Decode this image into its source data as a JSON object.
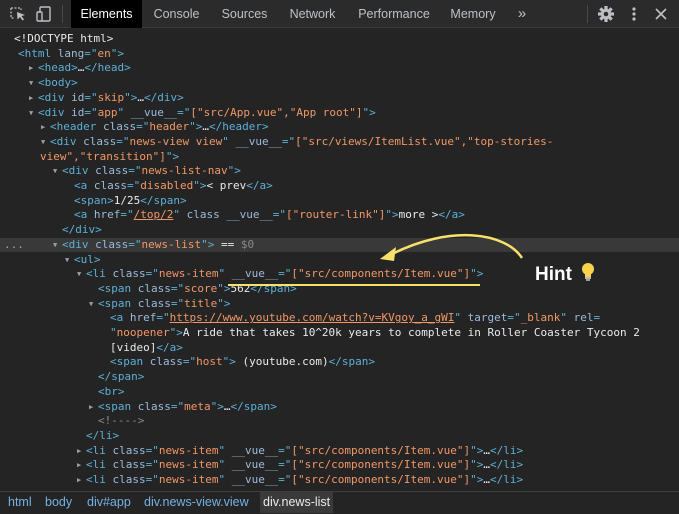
{
  "toolbar": {
    "tabs": [
      "Elements",
      "Console",
      "Sources",
      "Network",
      "Performance",
      "Memory"
    ],
    "more": "»",
    "icons": [
      "inspect-icon",
      "device-toggle-icon",
      "settings-icon",
      "more-vert-icon",
      "close-icon"
    ]
  },
  "lines": [
    [
      [
        "pl",
        "<!DOCTYPE html>"
      ]
    ],
    [
      [
        "tag",
        "<html "
      ],
      [
        "an",
        "lang"
      ],
      [
        "tag",
        "=\""
      ],
      [
        "av",
        "en"
      ],
      [
        "tag",
        "\">"
      ]
    ],
    [
      [
        "tag",
        "<head>"
      ],
      [
        "pl",
        "…"
      ],
      [
        "tag",
        "</head>"
      ]
    ],
    [
      [
        "tag",
        "<body>"
      ]
    ],
    [
      [
        "tag",
        "<div "
      ],
      [
        "an",
        "id"
      ],
      [
        "tag",
        "=\""
      ],
      [
        "av",
        "skip"
      ],
      [
        "tag",
        "\">"
      ],
      [
        "pl",
        "…"
      ],
      [
        "tag",
        "</div>"
      ]
    ],
    [
      [
        "tag",
        "<div "
      ],
      [
        "an",
        "id"
      ],
      [
        "tag",
        "=\""
      ],
      [
        "av",
        "app"
      ],
      [
        "tag",
        "\" "
      ],
      [
        "an",
        "__vue__"
      ],
      [
        "tag",
        "=\""
      ],
      [
        "av",
        "[\"src/App.vue\",\"App root\"]"
      ],
      [
        "tag",
        "\">"
      ]
    ],
    [
      [
        "tag",
        "<header "
      ],
      [
        "an",
        "class"
      ],
      [
        "tag",
        "=\""
      ],
      [
        "av",
        "header"
      ],
      [
        "tag",
        "\">"
      ],
      [
        "pl",
        "…"
      ],
      [
        "tag",
        "</header>"
      ]
    ],
    [
      [
        "tag",
        "<div "
      ],
      [
        "an",
        "class"
      ],
      [
        "tag",
        "=\""
      ],
      [
        "av",
        "news-view view"
      ],
      [
        "tag",
        "\" "
      ],
      [
        "an",
        "__vue__"
      ],
      [
        "tag",
        "=\""
      ],
      [
        "av",
        "[\"src/views/ItemList.vue\",\"top-stories-"
      ]
    ],
    [
      [
        "av",
        "view\",\"transition\"]"
      ],
      [
        "tag",
        "\">"
      ]
    ],
    [
      [
        "tag",
        "<div "
      ],
      [
        "an",
        "class"
      ],
      [
        "tag",
        "=\""
      ],
      [
        "av",
        "news-list-nav"
      ],
      [
        "tag",
        "\">"
      ]
    ],
    [
      [
        "tag",
        "<a "
      ],
      [
        "an",
        "class"
      ],
      [
        "tag",
        "=\""
      ],
      [
        "av",
        "disabled"
      ],
      [
        "tag",
        "\">"
      ],
      [
        "pl",
        "< prev"
      ],
      [
        "tag",
        "</a>"
      ]
    ],
    [
      [
        "tag",
        "<span>"
      ],
      [
        "pl",
        "1/25"
      ],
      [
        "tag",
        "</span>"
      ]
    ],
    [
      [
        "tag",
        "<a "
      ],
      [
        "an",
        "href"
      ],
      [
        "tag",
        "=\""
      ],
      [
        "avu",
        "/top/2"
      ],
      [
        "tag",
        "\" "
      ],
      [
        "an",
        "class"
      ],
      [
        "tag",
        " "
      ],
      [
        "an",
        "__vue__"
      ],
      [
        "tag",
        "=\""
      ],
      [
        "av",
        "[\"router-link\"]"
      ],
      [
        "tag",
        "\">"
      ],
      [
        "pl",
        "more >"
      ],
      [
        "tag",
        "</a>"
      ]
    ],
    [
      [
        "tag",
        "</div>"
      ]
    ],
    [
      [
        "tag",
        "<div "
      ],
      [
        "an",
        "class"
      ],
      [
        "tag",
        "=\""
      ],
      [
        "av",
        "news-list"
      ],
      [
        "tag",
        "\">"
      ],
      [
        "pl",
        " == "
      ],
      [
        "cm",
        "$0"
      ]
    ],
    [
      [
        "tag",
        "<ul>"
      ]
    ],
    [
      [
        "tag",
        "<li "
      ],
      [
        "an",
        "class"
      ],
      [
        "tag",
        "=\""
      ],
      [
        "av",
        "news-item"
      ],
      [
        "tag",
        "\" "
      ],
      [
        "an",
        "__vue__"
      ],
      [
        "tag",
        "=\""
      ],
      [
        "av",
        "[\"src/components/Item.vue\"]"
      ],
      [
        "tag",
        "\">"
      ]
    ],
    [
      [
        "tag",
        "<span "
      ],
      [
        "an",
        "class"
      ],
      [
        "tag",
        "=\""
      ],
      [
        "av",
        "score"
      ],
      [
        "tag",
        "\">"
      ],
      [
        "pl",
        "562"
      ],
      [
        "tag",
        "</span>"
      ]
    ],
    [
      [
        "tag",
        "<span "
      ],
      [
        "an",
        "class"
      ],
      [
        "tag",
        "=\""
      ],
      [
        "av",
        "title"
      ],
      [
        "tag",
        "\">"
      ]
    ],
    [
      [
        "tag",
        "<a "
      ],
      [
        "an",
        "href"
      ],
      [
        "tag",
        "=\""
      ],
      [
        "avu",
        "https://www.youtube.com/watch?v=KVgoy_a_gWI"
      ],
      [
        "tag",
        "\" "
      ],
      [
        "an",
        "target"
      ],
      [
        "tag",
        "=\""
      ],
      [
        "av",
        "_blank"
      ],
      [
        "tag",
        "\" "
      ],
      [
        "an",
        "rel"
      ],
      [
        "tag",
        "="
      ]
    ],
    [
      [
        "tag",
        "\""
      ],
      [
        "av",
        "noopener"
      ],
      [
        "tag",
        "\">"
      ],
      [
        "pl",
        "A ride that takes 10^20k years to complete in Roller Coaster Tycoon 2"
      ]
    ],
    [
      [
        "pl",
        "[video]"
      ],
      [
        "tag",
        "</a>"
      ]
    ],
    [
      [
        "tag",
        "<span "
      ],
      [
        "an",
        "class"
      ],
      [
        "tag",
        "=\""
      ],
      [
        "av",
        "host"
      ],
      [
        "tag",
        "\">"
      ],
      [
        "pl",
        " (youtube.com)"
      ],
      [
        "tag",
        "</span>"
      ]
    ],
    [
      [
        "tag",
        "</span>"
      ]
    ],
    [
      [
        "tag",
        "<br>"
      ]
    ],
    [
      [
        "tag",
        "<span "
      ],
      [
        "an",
        "class"
      ],
      [
        "tag",
        "=\""
      ],
      [
        "av",
        "meta"
      ],
      [
        "tag",
        "\">"
      ],
      [
        "pl",
        "…"
      ],
      [
        "tag",
        "</span>"
      ]
    ],
    [
      [
        "cm",
        "<!---->"
      ]
    ],
    [
      [
        "tag",
        "</li>"
      ]
    ],
    [
      [
        "tag",
        "<li "
      ],
      [
        "an",
        "class"
      ],
      [
        "tag",
        "=\""
      ],
      [
        "av",
        "news-item"
      ],
      [
        "tag",
        "\" "
      ],
      [
        "an",
        "__vue__"
      ],
      [
        "tag",
        "=\""
      ],
      [
        "av",
        "[\"src/components/Item.vue\"]"
      ],
      [
        "tag",
        "\">"
      ],
      [
        "pl",
        "…"
      ],
      [
        "tag",
        "</li>"
      ]
    ],
    [
      [
        "tag",
        "<li "
      ],
      [
        "an",
        "class"
      ],
      [
        "tag",
        "=\""
      ],
      [
        "av",
        "news-item"
      ],
      [
        "tag",
        "\" "
      ],
      [
        "an",
        "__vue__"
      ],
      [
        "tag",
        "=\""
      ],
      [
        "av",
        "[\"src/components/Item.vue\"]"
      ],
      [
        "tag",
        "\">"
      ],
      [
        "pl",
        "…"
      ],
      [
        "tag",
        "</li>"
      ]
    ],
    [
      [
        "tag",
        "<li "
      ],
      [
        "an",
        "class"
      ],
      [
        "tag",
        "=\""
      ],
      [
        "av",
        "news-item"
      ],
      [
        "tag",
        "\" "
      ],
      [
        "an",
        "__vue__"
      ],
      [
        "tag",
        "=\""
      ],
      [
        "av",
        "[\"src/components/Item.vue\"]"
      ],
      [
        "tag",
        "\">"
      ],
      [
        "pl",
        "…"
      ],
      [
        "tag",
        "</li>"
      ]
    ]
  ],
  "selected_line_marker": "...",
  "annotation": {
    "text": "Hint",
    "icon": "lightbulb-icon",
    "color": "#f7e16b"
  },
  "breadcrumbs": [
    {
      "text": "html",
      "color": "#74b1e3"
    },
    {
      "text": "body",
      "color": "#74b1e3"
    },
    {
      "text": "div#app",
      "color": "#74b1e3"
    },
    {
      "text": "div.news-view.view",
      "color": "#74b1e3"
    },
    {
      "text": "div.news-list",
      "color": "#e8eaed"
    }
  ]
}
